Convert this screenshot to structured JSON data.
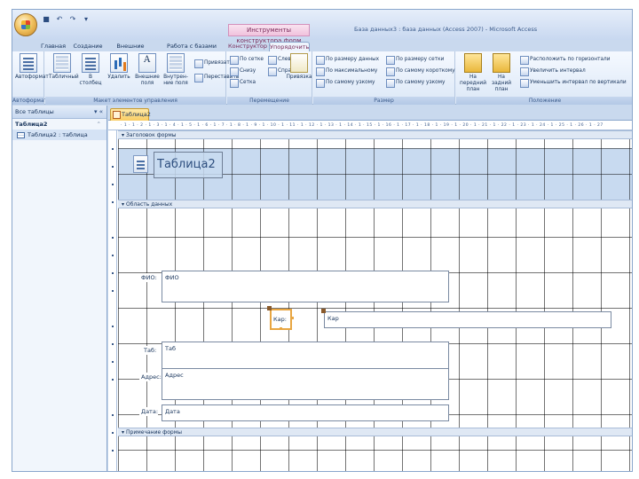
{
  "title": {
    "context_tab_group": "Инструменты конструктора форм",
    "app_title": "База данных3 : база данных (Access 2007) - Microsoft Access"
  },
  "qat": {
    "undo_glyph": "↶",
    "redo_glyph": "↷",
    "save_glyph": "■",
    "more_glyph": "▾"
  },
  "ribbon_tabs": [
    "Главная",
    "Создание",
    "Внешние данные",
    "Работа с базами данных",
    "Конструктор",
    "Упорядочить"
  ],
  "ribbon": {
    "groups": [
      "Автоформат",
      "Макет элементов управления",
      "Перемещение",
      "Размер",
      "Положение"
    ],
    "autoformat_label": "Автоформат",
    "tabular_label": "Табличный",
    "in_columns_label": "В столбец",
    "delete_label": "Удалить",
    "padding_left_label": "Вне­шние поля",
    "padding_inner_label": "Внутрен­ние поля",
    "snap_grid_label": "Привязать",
    "tab_order_label": "Переставить",
    "top_label": "По сетке",
    "left_label": "Слева",
    "bottom_label": "Снизу",
    "right_label": "Справа",
    "grid_label": "Сетка",
    "aligns_label": "Привязка",
    "to_fit_label": "По размеру данных",
    "to_grid_label": "По размеру сетки",
    "to_tallest_label": "По максимальному",
    "to_shortest_label": "По самому короткому",
    "to_widest_label": "По самому узкому",
    "to_narrowest_label": "По самому узкому",
    "bring_front_label": "На передний план",
    "send_back_label": "На задний план",
    "spacing_h_label": "Расположить по горизонтали",
    "spacing_v_label": "Увеличить интервал",
    "spacing_dec_label": "Уменьшить интервал по вертикали"
  },
  "nav": {
    "header": "Все таблицы",
    "group": "Таблица2",
    "item": "Таблица2 : таблица"
  },
  "document": {
    "tab": "Таблица2",
    "ruler_text": "· 1 · 1 · 2 · 1 · 3 · 1 · 4 · 1 · 5 · 1 · 6 · 1 · 7 · 1 · 8 · 1 · 9 · 1 · 10 · 1 · 11 · 1 · 12 · 1 · 13 · 1 · 14 · 1 · 15 · 1 · 16 · 1 · 17 · 1 · 18 · 1 · 19 · 1 · 20 · 1 · 21 · 1 · 22 · 1 · 23 · 1 · 24 · 1 · 25 · 1 · 26 · 1 · 27",
    "sections": {
      "header": "Заголовок формы",
      "detail": "Область данных",
      "footer": "Примечание формы"
    },
    "form_title": "Таблица2",
    "fields": [
      {
        "label": "ФИО:",
        "value": "ФИО"
      },
      {
        "label": "Кар:",
        "value": "Кар"
      },
      {
        "label": "Таб:",
        "value": "Таб"
      },
      {
        "label": "Адрес:",
        "value": "Адрес"
      },
      {
        "label": "Дата:",
        "value": "Дата"
      }
    ]
  },
  "colors": {
    "context_tab": "#f0c2dd",
    "active_doc_tab": "#f9cd63",
    "selection": "#e8a642",
    "header_section": "#c8daf0"
  }
}
